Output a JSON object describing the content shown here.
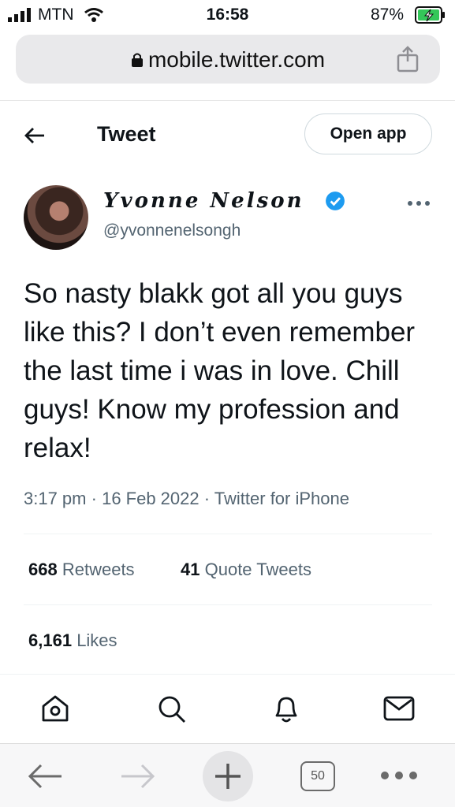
{
  "status_bar": {
    "carrier": "MTN",
    "time": "16:58",
    "battery": "87%"
  },
  "browser": {
    "url": "mobile.twitter.com",
    "tab_count": "50"
  },
  "header": {
    "title": "Tweet",
    "open_app_label": "Open app"
  },
  "tweet": {
    "author_name": "Yvonne Nelson",
    "handle": "@yvonnenelsongh",
    "text": "So nasty blakk got all you guys like this? I don’t even remember the last time i was in love. Chill guys! Know my profession and relax!",
    "time": "3:17 pm",
    "date": "16 Feb 2022",
    "source": "Twitter for iPhone",
    "retweets_count": "668",
    "retweets_label": "Retweets",
    "quotes_count": "41",
    "quotes_label": "Quote Tweets",
    "likes_count": "6,161",
    "likes_label": "Likes"
  },
  "colors": {
    "twitter_blue": "#1d9bf0",
    "secondary_text": "#536471",
    "battery_green": "#34c759"
  },
  "icons": [
    "wifi-icon",
    "signal-icon",
    "battery-icon",
    "lock-icon",
    "share-icon",
    "back-arrow-icon",
    "verified-icon",
    "more-icon",
    "home-icon",
    "search-icon",
    "notifications-icon",
    "messages-icon",
    "browser-back-icon",
    "browser-forward-icon",
    "new-tab-icon",
    "tabs-icon",
    "browser-more-icon"
  ]
}
